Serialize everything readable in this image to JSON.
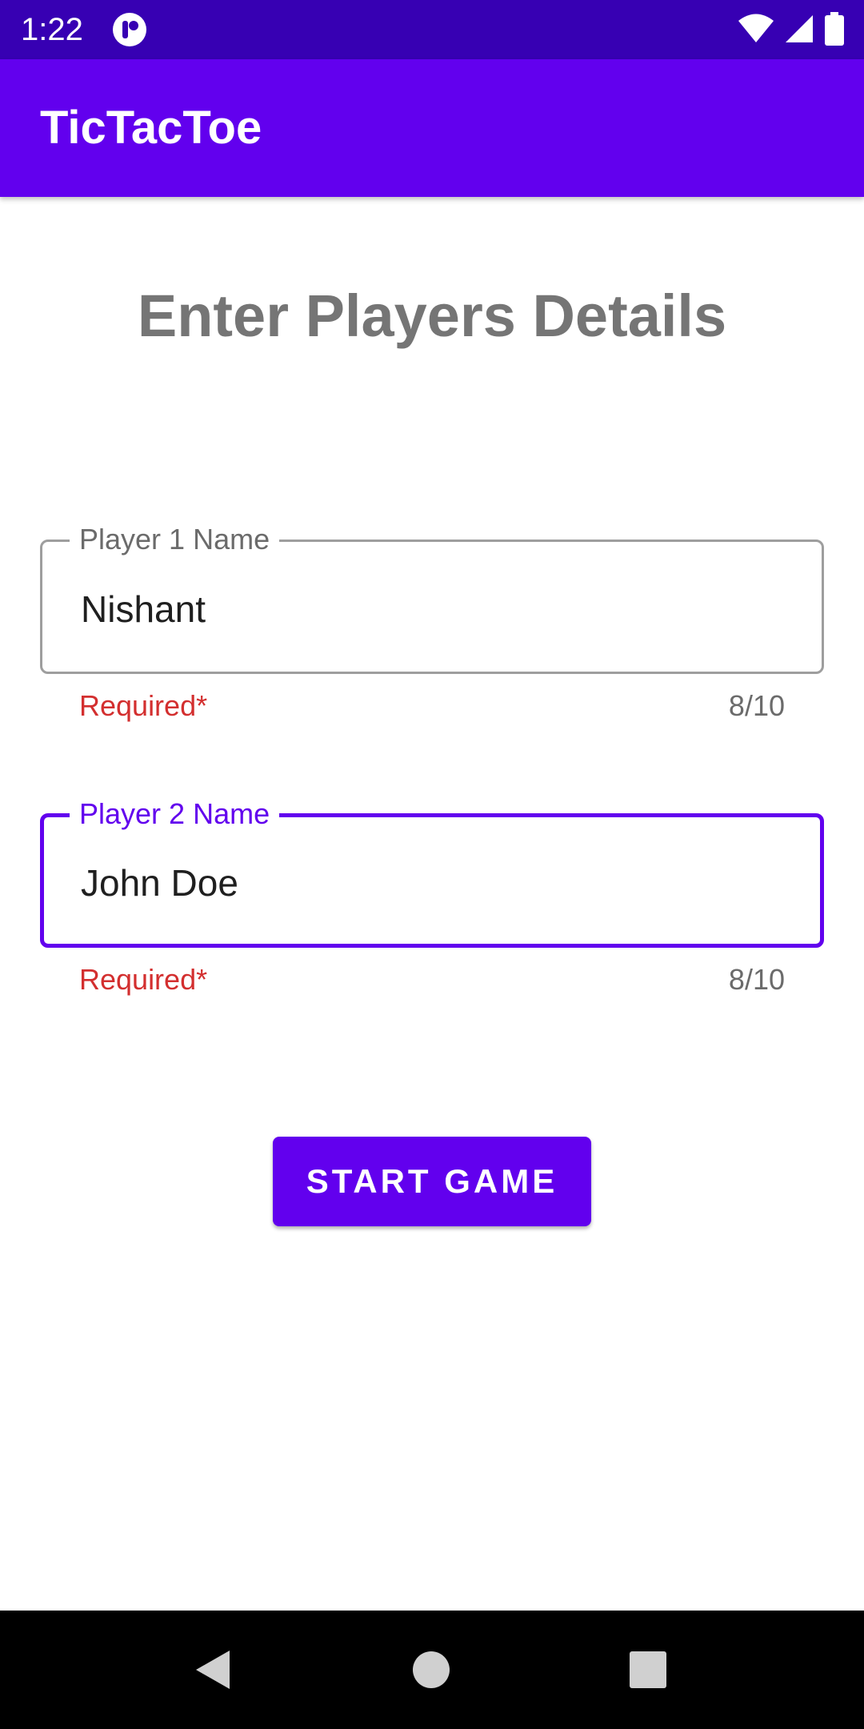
{
  "status_bar": {
    "time": "1:22",
    "icons": [
      "app-notification-icon",
      "wifi-icon",
      "cell-signal-icon",
      "battery-icon"
    ],
    "background": "#3700b3"
  },
  "app_bar": {
    "title": "TicTacToe",
    "background": "#6200ee"
  },
  "main": {
    "heading": "Enter Players Details",
    "fields": [
      {
        "label": "Player 1 Name",
        "value": "Nishant",
        "helper": "Required*",
        "counter": "8/10",
        "focused": false
      },
      {
        "label": "Player 2 Name",
        "value": "John Doe",
        "helper": "Required*",
        "counter": "8/10",
        "focused": true
      }
    ],
    "start_button": "START GAME"
  },
  "nav_bar": {
    "buttons": [
      "back-icon",
      "home-icon",
      "recents-icon"
    ]
  },
  "colors": {
    "primary": "#6200ee",
    "primary_dark": "#3700b3",
    "error": "#d32f2f",
    "heading": "#757575"
  }
}
